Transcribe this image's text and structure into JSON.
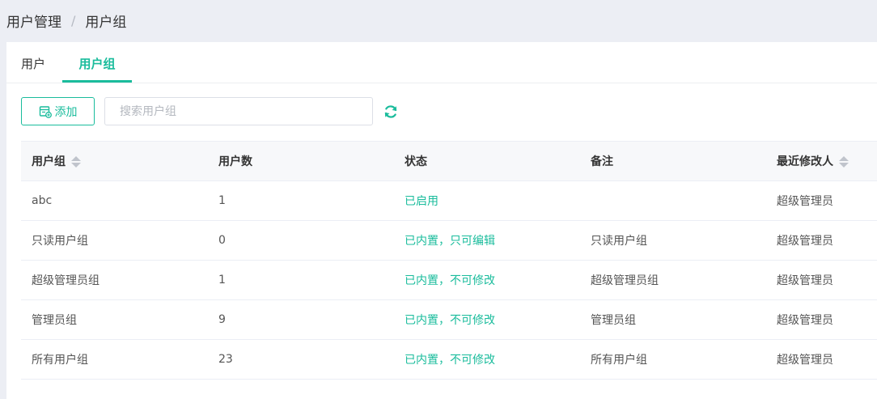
{
  "breadcrumb": {
    "parent": "用户管理",
    "separator": "/",
    "current": "用户组"
  },
  "tabs": [
    {
      "label": "用户",
      "active": false
    },
    {
      "label": "用户组",
      "active": true
    }
  ],
  "toolbar": {
    "add_label": "添加",
    "search_placeholder": "搜索用户组",
    "icons": [
      "add-icon",
      "refresh-icon"
    ]
  },
  "table": {
    "columns": [
      "用户组",
      "用户数",
      "状态",
      "备注",
      "最近修改人"
    ],
    "rows": [
      {
        "group": "abc",
        "count": "1",
        "status": "已启用",
        "note": "",
        "modifier": "超级管理员"
      },
      {
        "group": "只读用户组",
        "count": "0",
        "status": "已内置，只可编辑",
        "note": "只读用户组",
        "modifier": "超级管理员"
      },
      {
        "group": "超级管理员组",
        "count": "1",
        "status": "已内置，不可修改",
        "note": "超级管理员组",
        "modifier": "超级管理员"
      },
      {
        "group": "管理员组",
        "count": "9",
        "status": "已内置，不可修改",
        "note": "管理员组",
        "modifier": "超级管理员"
      },
      {
        "group": "所有用户组",
        "count": "23",
        "status": "已内置，不可修改",
        "note": "所有用户组",
        "modifier": "超级管理员"
      }
    ]
  },
  "colors": {
    "accent": "#1abc9c",
    "background": "#eceef4"
  }
}
